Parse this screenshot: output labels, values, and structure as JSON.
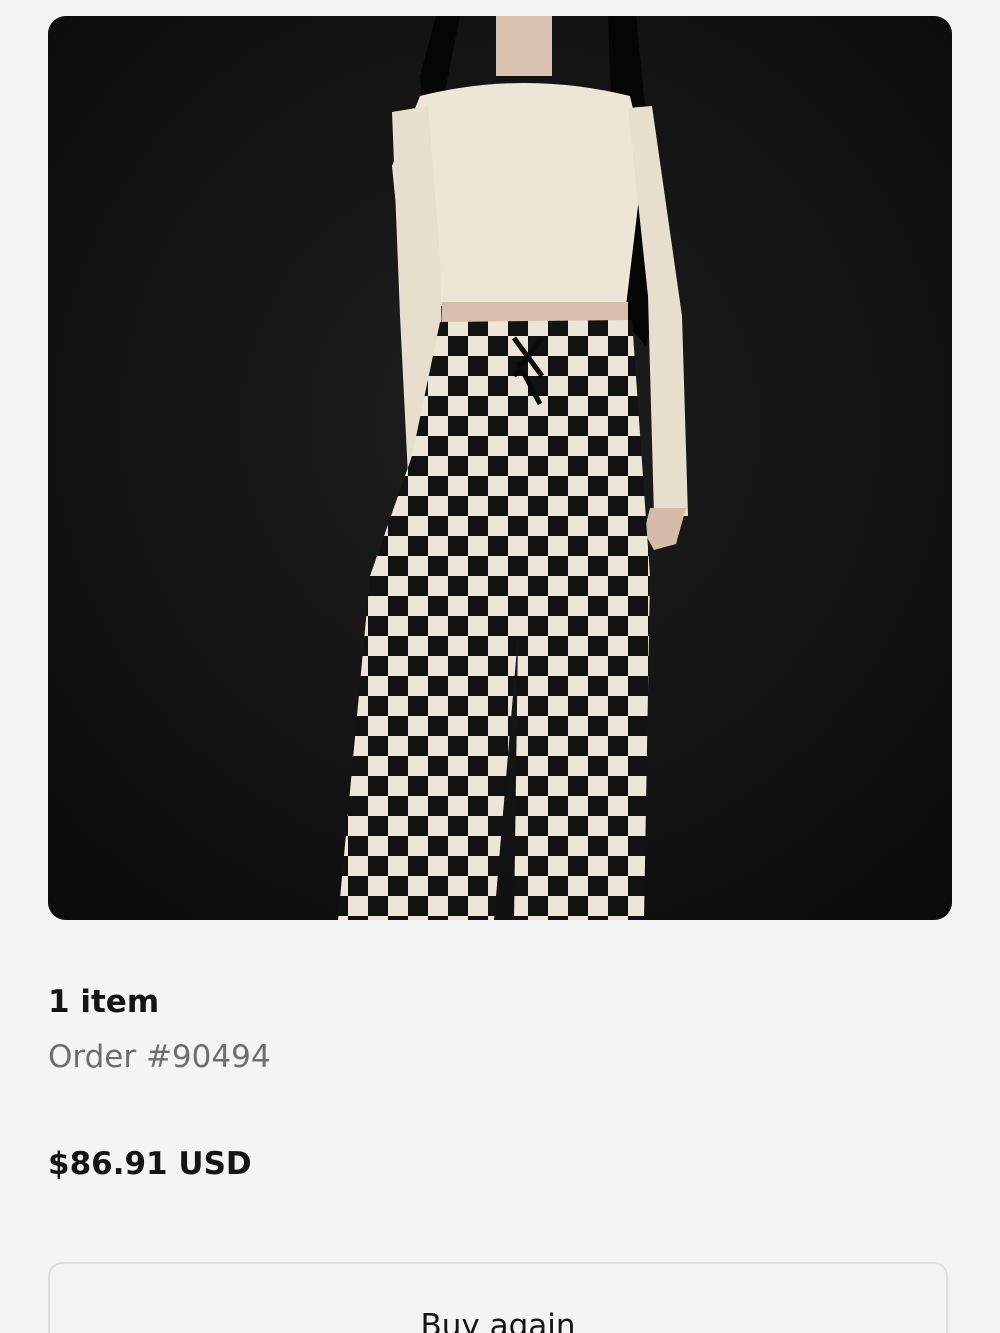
{
  "product": {
    "image_alt": "Model wearing cream cropped long-sleeve top and black and white checkered lace-up pants"
  },
  "order": {
    "item_count": "1 item",
    "order_number": "Order #90494",
    "total": "$86.91 USD"
  },
  "actions": {
    "buy_again_label": "Buy again"
  }
}
